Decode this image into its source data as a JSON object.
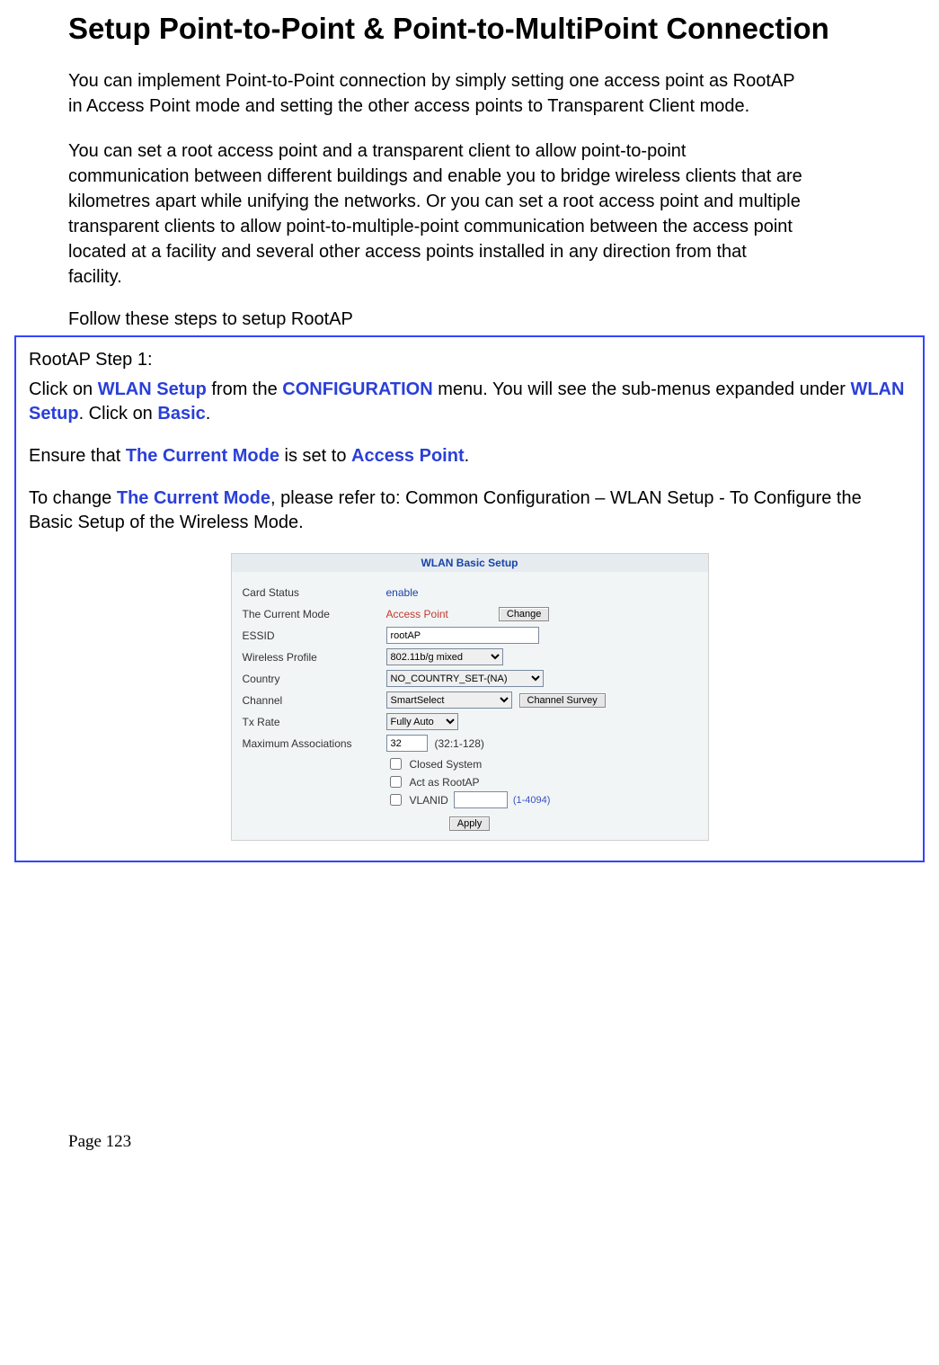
{
  "title": "Setup Point-to-Point & Point-to-MultiPoint Connection",
  "intro1": "You can implement Point-to-Point connection by simply setting one access point as RootAP in Access Point mode and setting the other access points to Transparent Client mode.",
  "intro2": "You can set a root access point and a transparent client to allow point-to-point communication between different buildings and enable you to bridge wireless clients that are kilometres apart while unifying the networks. Or you can set a root access point and multiple transparent clients to allow point-to-multiple-point communication between the access point located at a facility and several other access points installed in any direction from that facility.",
  "intro3": "Follow these steps to setup RootAP",
  "callout": {
    "heading": "RootAP Step 1:",
    "seg": {
      "p1a": "Click on ",
      "wlan_setup": "WLAN Setup",
      "p1b": " from the ",
      "configuration": "CONFIGURATION",
      "p1c": " menu. You will see the sub-menus expanded under ",
      "p1d": ". Click on ",
      "basic": "Basic",
      "p1e": ".",
      "p2a": "Ensure that ",
      "current_mode": "The Current Mode",
      "p2b": " is set to ",
      "access_point": "Access Point",
      "p2c": ".",
      "p3a": "To change ",
      "p3b": ", please refer to: Common Configuration – WLAN Setup - To Configure the Basic Setup of the Wireless Mode."
    }
  },
  "wlan": {
    "panel_title": "WLAN Basic Setup",
    "labels": {
      "card_status": "Card Status",
      "current_mode": "The Current Mode",
      "essid": "ESSID",
      "wireless_profile": "Wireless Profile",
      "country": "Country",
      "channel": "Channel",
      "tx_rate": "Tx Rate",
      "max_assoc": "Maximum Associations"
    },
    "values": {
      "card_status": "enable",
      "current_mode": "Access Point",
      "essid": "rootAP",
      "wireless_profile": "802.11b/g mixed",
      "country": "NO_COUNTRY_SET-(NA)",
      "channel": "SmartSelect",
      "tx_rate": "Fully Auto",
      "max_assoc": "32",
      "max_assoc_hint": "(32:1-128)",
      "vlanid_hint": "(1-4094)"
    },
    "checks": {
      "closed_system": "Closed System",
      "act_as_rootap": "Act as RootAP",
      "vlanid": "VLANID"
    },
    "buttons": {
      "change": "Change",
      "channel_survey": "Channel Survey",
      "apply": "Apply"
    }
  },
  "page_number": "Page 123"
}
